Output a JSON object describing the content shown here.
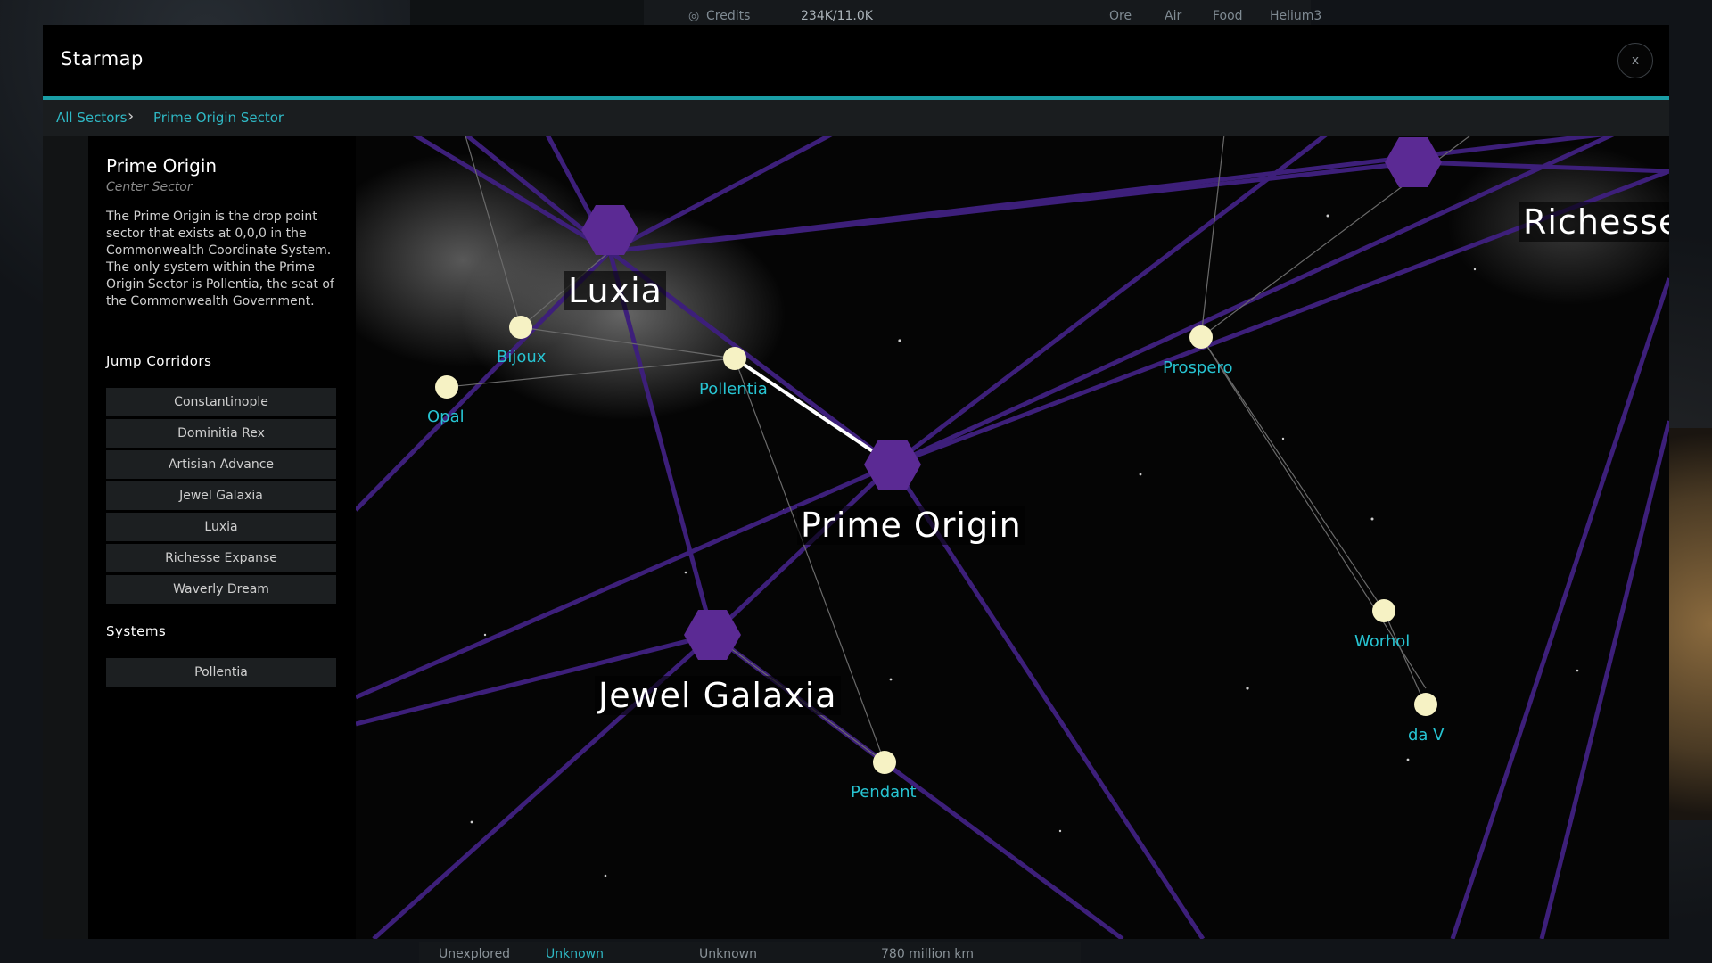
{
  "hud": {
    "credits_label": "Credits",
    "credits_value": "234K/11.0K",
    "resources": [
      "Ore",
      "Air",
      "Food",
      "Helium3"
    ]
  },
  "footer": {
    "cells": [
      "Unexplored",
      "Unknown",
      "Unknown",
      "780 million km"
    ]
  },
  "modal": {
    "title": "Starmap",
    "close_label": "x"
  },
  "breadcrumb": {
    "items": [
      "All Sectors",
      "Prime Origin Sector"
    ],
    "separator": "›"
  },
  "sidebar": {
    "sector_name": "Prime Origin",
    "sector_subtitle": "Center Sector",
    "description": "The Prime Origin is the drop point sector that exists at 0,0,0 in the Commonwealth Coordinate System. The only system within the Prime Origin Sector is Pollentia, the seat of the Commonwealth Government.",
    "jump_corridors_title": "Jump Corridors",
    "jump_corridors": [
      "Constantinople",
      "Dominitia Rex",
      "Artisian Advance",
      "Jewel Galaxia",
      "Luxia",
      "Richesse Expanse",
      "Waverly Dream"
    ],
    "systems_title": "Systems",
    "systems": [
      "Pollentia"
    ]
  },
  "map": {
    "sectors": [
      "Luxia",
      "Prime Origin",
      "Jewel Galaxia",
      "Richesse"
    ],
    "systems": [
      "Bijoux",
      "Opal",
      "Pollentia",
      "Prospero",
      "Worhol",
      "da V",
      "Pendant"
    ],
    "colors": {
      "corridor": "#3d1f7a",
      "sector_hex": "#5b2a94",
      "system_star": "#f6f2c4",
      "system_label": "#27c4d2",
      "accent": "#1a9ea6"
    }
  }
}
